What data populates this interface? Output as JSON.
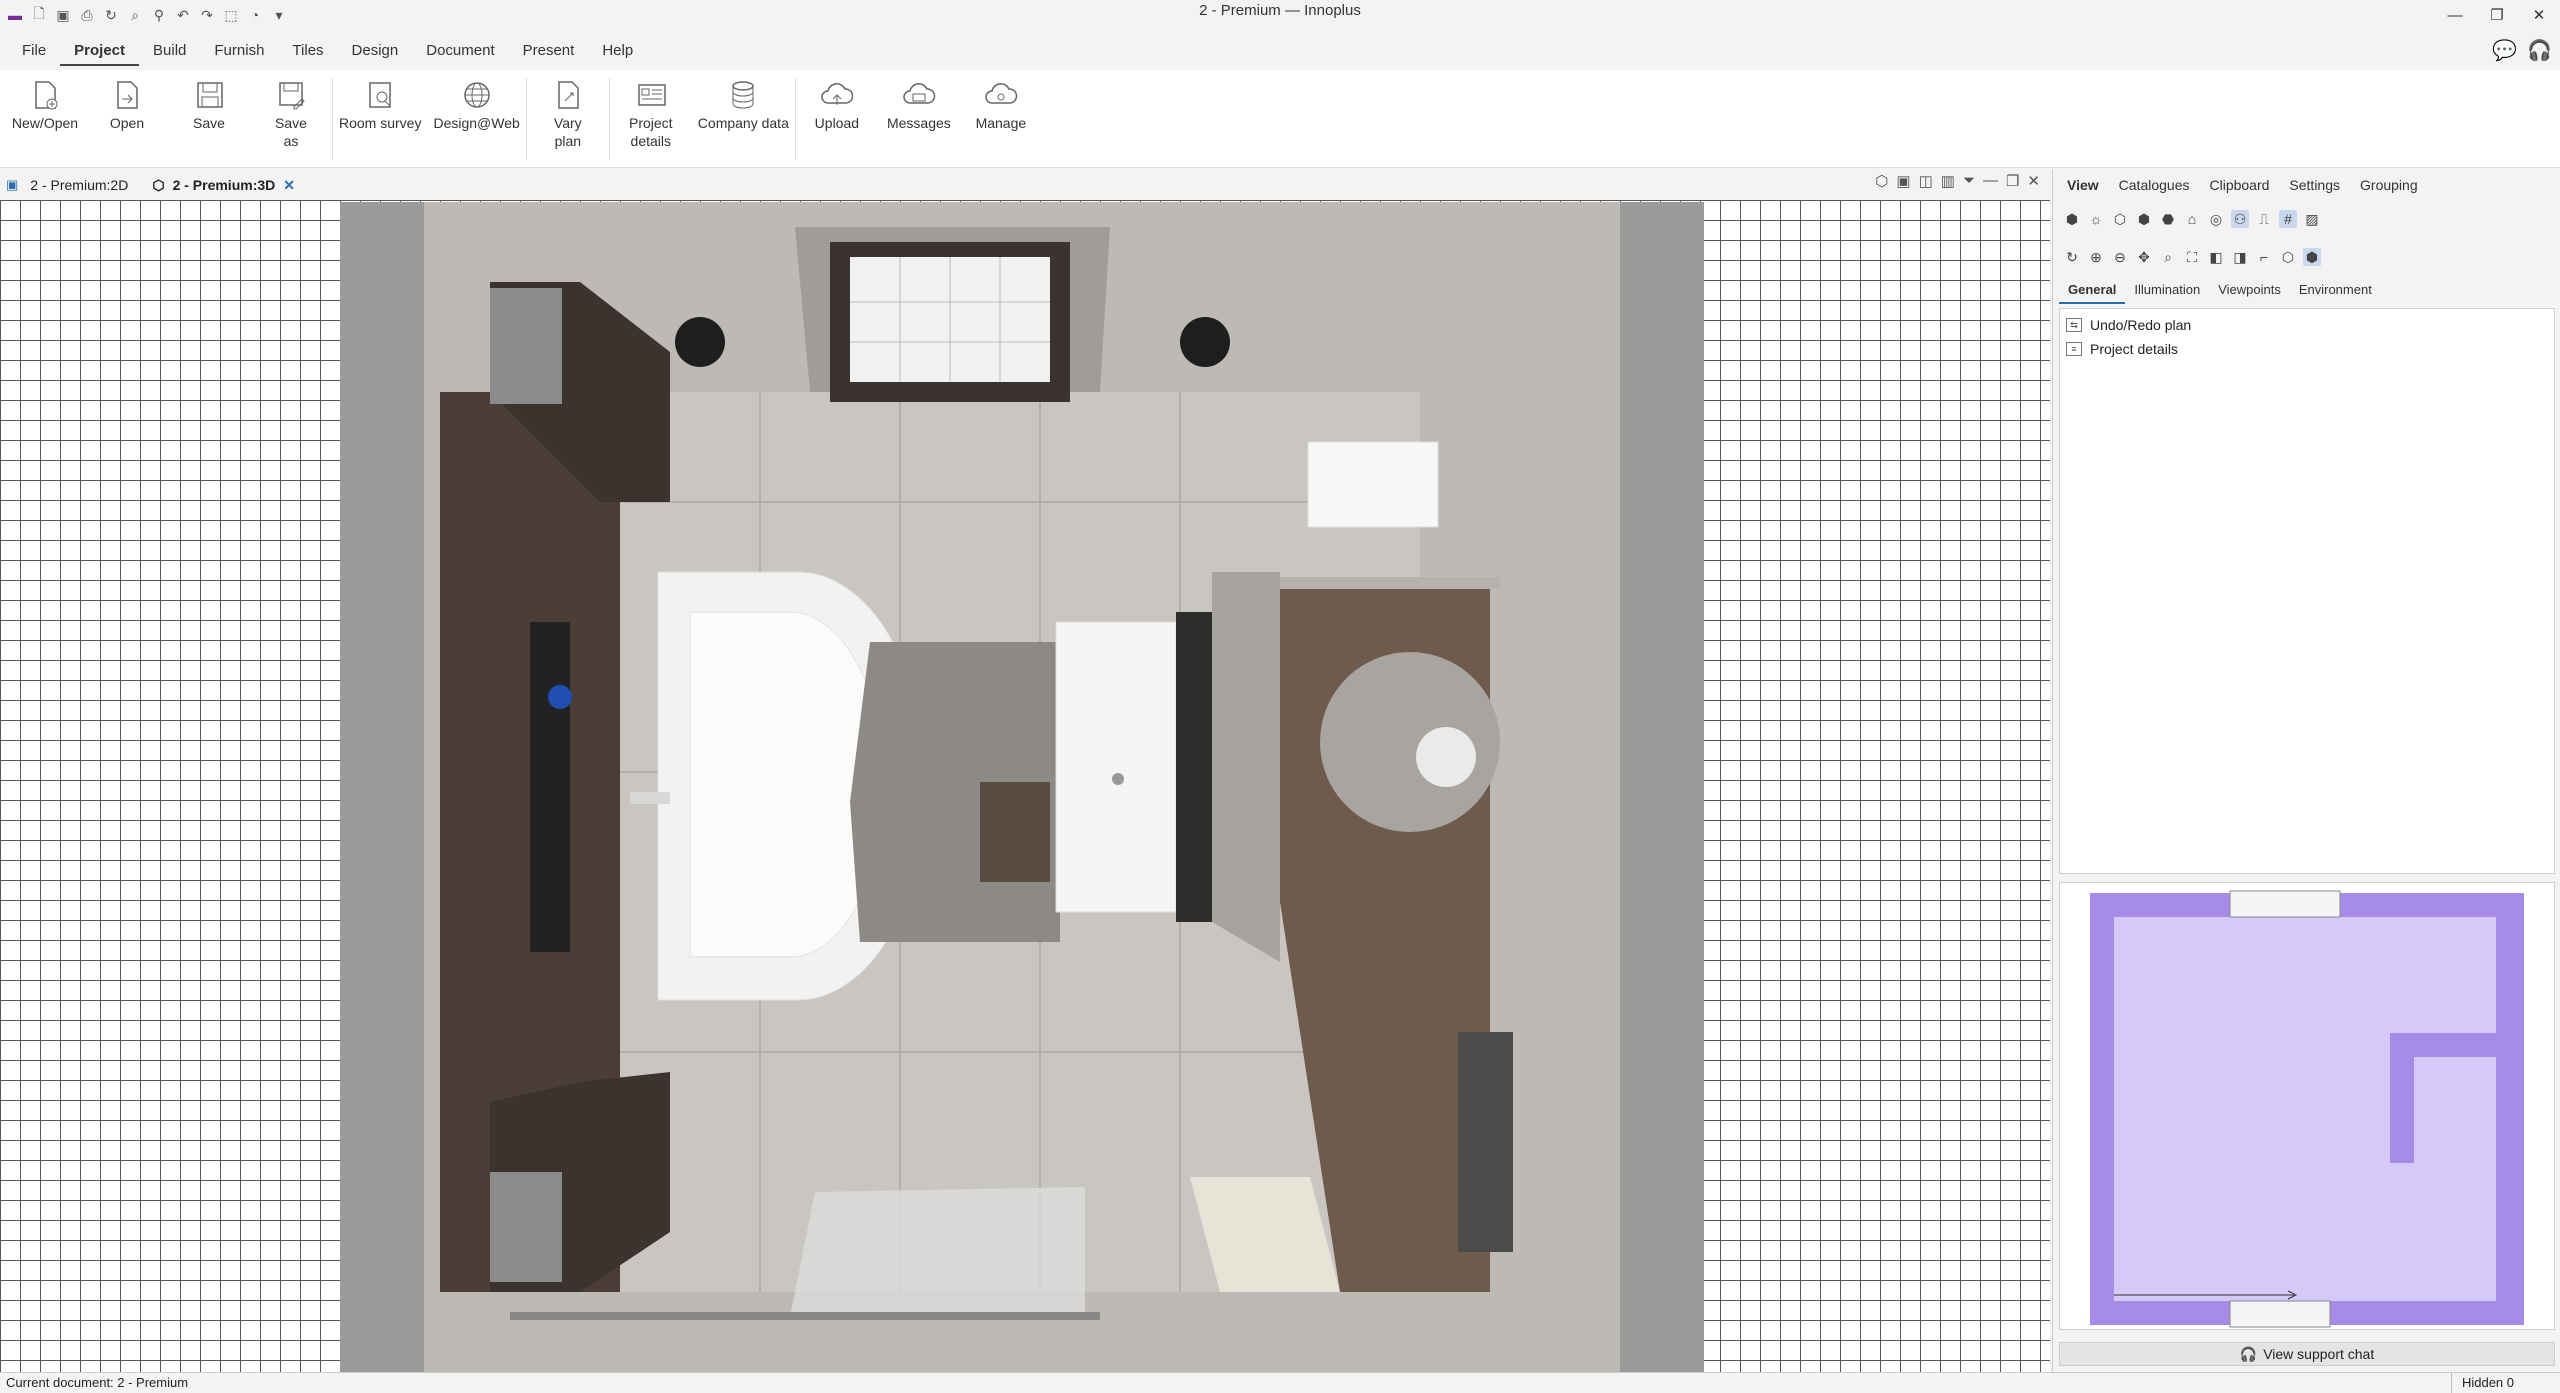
{
  "window": {
    "title": "2 - Premium — Innoplus"
  },
  "quick_access": [
    "app-logo-icon",
    "new-doc-icon",
    "save-icon",
    "print-icon",
    "refresh-icon",
    "zoom-icon",
    "search-icon",
    "undo-icon",
    "redo-icon",
    "select-icon",
    "help-icon",
    "dropdown-icon"
  ],
  "menu": [
    {
      "label": "File",
      "active": false
    },
    {
      "label": "Project",
      "active": true
    },
    {
      "label": "Build",
      "active": false
    },
    {
      "label": "Furnish",
      "active": false
    },
    {
      "label": "Tiles",
      "active": false
    },
    {
      "label": "Design",
      "active": false
    },
    {
      "label": "Document",
      "active": false
    },
    {
      "label": "Present",
      "active": false
    },
    {
      "label": "Help",
      "active": false
    }
  ],
  "ribbon": [
    {
      "label": "New/Open",
      "icon": "new-open-icon"
    },
    {
      "label": "Open",
      "icon": "open-icon"
    },
    {
      "label": "Save",
      "icon": "save-icon"
    },
    {
      "label": "Save\nas",
      "icon": "save-as-icon"
    },
    {
      "label": "Room survey",
      "icon": "room-survey-icon"
    },
    {
      "label": "Design@Web",
      "icon": "globe-icon"
    },
    {
      "label": "Vary\nplan",
      "icon": "vary-plan-icon"
    },
    {
      "label": "Project\ndetails",
      "icon": "project-details-icon"
    },
    {
      "label": "Company data",
      "icon": "database-icon"
    },
    {
      "label": "Upload",
      "icon": "cloud-upload-icon"
    },
    {
      "label": "Messages",
      "icon": "cloud-messages-icon"
    },
    {
      "label": "Manage",
      "icon": "cloud-manage-icon"
    }
  ],
  "doc_tabs": [
    {
      "label": "2 - Premium:2D",
      "active": false
    },
    {
      "label": "2 - Premium:3D",
      "active": true
    }
  ],
  "right_panel": {
    "tabs": [
      "View",
      "Catalogues",
      "Clipboard",
      "Settings",
      "Grouping"
    ],
    "active_tab": "View",
    "sub_tabs": [
      "General",
      "Illumination",
      "Viewpoints",
      "Environment"
    ],
    "active_sub_tab": "General",
    "tree_items": [
      "Undo/Redo plan",
      "Project details"
    ],
    "support_label": "View support chat"
  },
  "status": {
    "current_document": "Current document: 2 - Premium",
    "hidden": "Hidden 0"
  },
  "colors": {
    "minimap_wall": "#a78be8",
    "minimap_floor": "#d4c9f7",
    "grid_line": "#555555"
  }
}
